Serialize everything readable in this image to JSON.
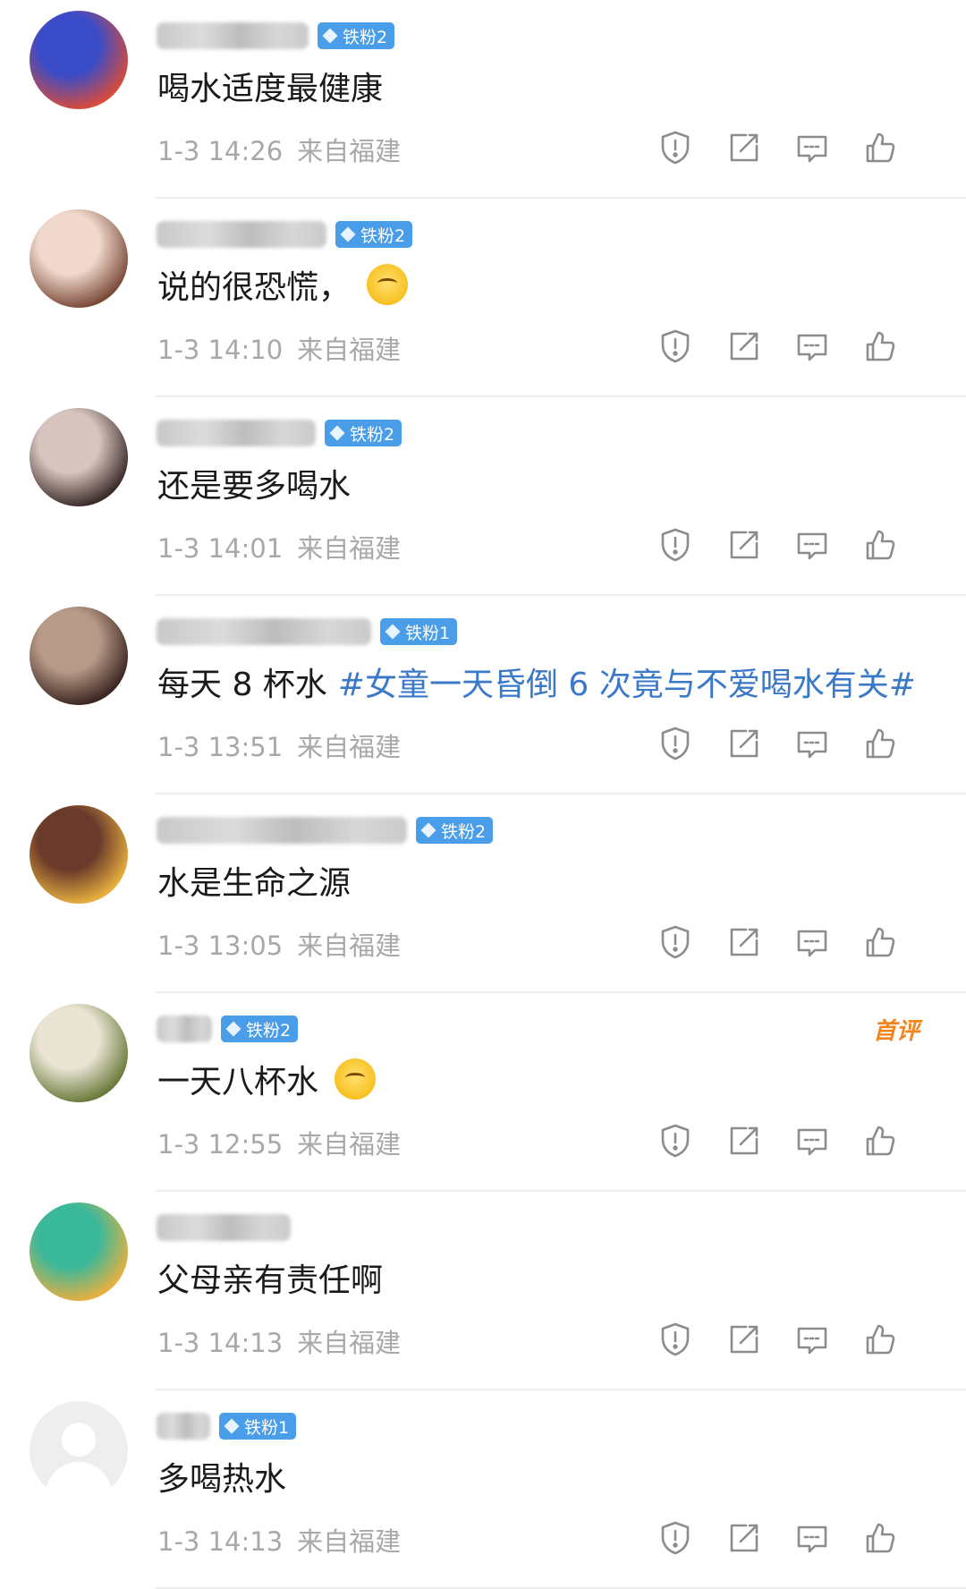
{
  "colors": {
    "badge": "#4a9de8",
    "topic": "#3a78c8",
    "meta": "#a8a8a8",
    "first": "#f5831e"
  },
  "comments": [
    {
      "badge": "铁粉2",
      "text": "喝水适度最健康",
      "time": "1-3 14:26",
      "location": "来自福建",
      "avatar": [
        "#3a4cc8",
        "#d94b3a"
      ]
    },
    {
      "badge": "铁粉2",
      "text": "说的很恐慌，",
      "emoji": "laugh-cry-emoji",
      "time": "1-3 14:10",
      "location": "来自福建",
      "avatar": [
        "#f0d8cc",
        "#7a4a38"
      ]
    },
    {
      "badge": "铁粉2",
      "text": "还是要多喝水",
      "time": "1-3 14:01",
      "location": "来自福建",
      "avatar": [
        "#d8c4be",
        "#3a2a28"
      ]
    },
    {
      "badge": "铁粉1",
      "text": "每天 8 杯水",
      "topic": "#女童一天昏倒 6 次竟与不爱喝水有关#",
      "time": "1-3 13:51",
      "location": "来自福建",
      "avatar": [
        "#b89a88",
        "#3a2520"
      ]
    },
    {
      "badge": "铁粉2",
      "text": "水是生命之源",
      "time": "1-3 13:05",
      "location": "来自福建",
      "avatar": [
        "#6a3a2a",
        "#e8b040"
      ]
    },
    {
      "badge": "铁粉2",
      "text": "一天八杯水",
      "emoji": "glasses-emoji",
      "first": "首评",
      "time": "1-3 12:55",
      "location": "来自福建",
      "avatar": [
        "#eae4d4",
        "#6a7a3a"
      ]
    },
    {
      "text": "父母亲有责任啊",
      "time": "1-3 14:13",
      "location": "来自福建",
      "avatar": [
        "#3ab89a",
        "#e8b040"
      ]
    },
    {
      "badge": "铁粉1",
      "text": "多喝热水",
      "time": "1-3 14:13",
      "location": "来自福建",
      "avatar": []
    }
  ]
}
